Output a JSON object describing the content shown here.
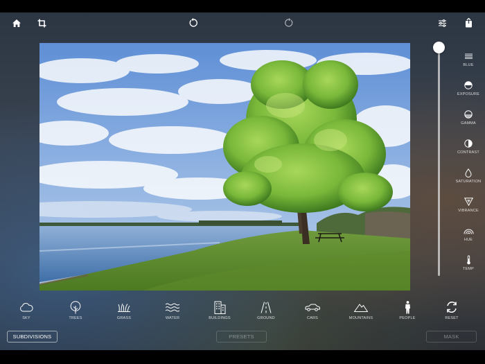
{
  "toolbar": {
    "buttons": [
      "home-icon",
      "crop-icon",
      "undo-icon",
      "redo-icon",
      "settings-sliders-icon",
      "share-icon"
    ]
  },
  "slider": {
    "value": 1.0
  },
  "adjustments": [
    {
      "label": "BLUE",
      "icon": "blue-icon"
    },
    {
      "label": "EXPOSURE",
      "icon": "exposure-icon"
    },
    {
      "label": "GAMMA",
      "icon": "gamma-icon"
    },
    {
      "label": "CONTRAST",
      "icon": "contrast-icon"
    },
    {
      "label": "SATURATION",
      "icon": "saturation-icon"
    },
    {
      "label": "VIBRANCE",
      "icon": "vibrance-icon"
    },
    {
      "label": "HUE",
      "icon": "hue-icon"
    },
    {
      "label": "TEMP",
      "icon": "temp-icon"
    }
  ],
  "categories": [
    {
      "label": "SKY",
      "icon": "cloud-icon"
    },
    {
      "label": "TREES",
      "icon": "tree-icon"
    },
    {
      "label": "GRASS",
      "icon": "grass-icon"
    },
    {
      "label": "WATER",
      "icon": "water-icon"
    },
    {
      "label": "BUILDINGS",
      "icon": "buildings-icon"
    },
    {
      "label": "GROUND",
      "icon": "road-icon"
    },
    {
      "label": "CARS",
      "icon": "car-icon"
    },
    {
      "label": "MOUNTAINS",
      "icon": "mountain-icon"
    },
    {
      "label": "PEOPLE",
      "icon": "person-icon"
    },
    {
      "label": "RESET",
      "icon": "reset-icon"
    }
  ],
  "bottom": {
    "subdivisions": "SUBDIVISIONS",
    "presets": "PRESETS",
    "mask": "MASK"
  }
}
